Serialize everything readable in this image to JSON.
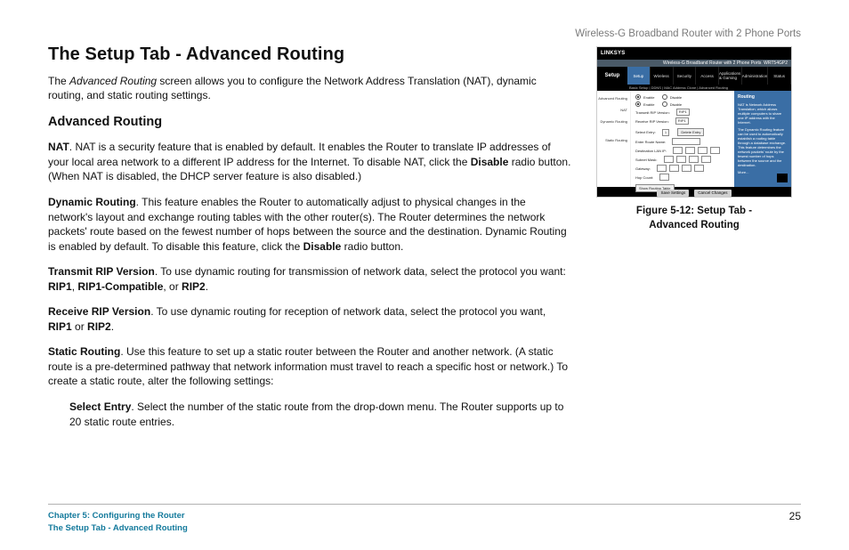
{
  "product_title": "Wireless-G Broadband Router with 2 Phone Ports",
  "page_heading": "The Setup Tab - Advanced Routing",
  "intro_prefix": "The ",
  "intro_ital": "Advanced Routing",
  "intro_suffix": " screen allows you to configure the Network Address Translation (NAT), dynamic routing, and static routing settings.",
  "sub_heading": "Advanced Routing",
  "nat_label": "NAT",
  "nat_text_1": ". NAT is a security feature that is enabled by default. It enables the Router to translate IP addresses of your local area network to a different IP address for the Internet. To disable NAT, click the ",
  "nat_bold_disable": "Disable",
  "nat_text_2": " radio button. (When NAT is disabled, the DHCP server feature is also disabled.)",
  "dyn_label": "Dynamic Routing",
  "dyn_text_1": ". This feature enables the Router to automatically adjust to physical changes in the network's layout and exchange routing tables with the other router(s). The Router determines the network packets' route based on the fewest number of hops between the source and the destination. Dynamic Routing is enabled by default. To disable this feature, click the ",
  "dyn_bold_disable": "Disable",
  "dyn_text_2": " radio button.",
  "trip_label": "Transmit RIP Version",
  "trip_text_1": ". To use dynamic routing for transmission of network data, select the protocol you want: ",
  "trip_b1": "RIP1",
  "trip_sep1": ", ",
  "trip_b2": "RIP1-Compatible",
  "trip_sep2": ", or ",
  "trip_b3": "RIP2",
  "trip_end": ".",
  "rrip_label": "Receive RIP Version",
  "rrip_text_1": ". To use dynamic routing for reception of network data, select the protocol you want, ",
  "rrip_b1": "RIP1",
  "rrip_sep": " or ",
  "rrip_b2": "RIP2",
  "rrip_end": ".",
  "static_label": "Static Routing",
  "static_text": ". Use this feature to set up a static router between the Router and another network. (A static route is a pre-determined pathway that network information must travel to reach a specific host or network.) To create a static route, alter the following settings:",
  "select_label": "Select Entry",
  "select_text": ". Select the number of the static route from the drop-down menu. The Router supports up to 20 static route entries.",
  "figure_caption_line1": "Figure 5-12: Setup Tab -",
  "figure_caption_line2": "Advanced Routing",
  "footer_chapter": "Chapter 5: Configuring the Router",
  "footer_section": "The Setup Tab - Advanced Routing",
  "page_number": "25",
  "thumb": {
    "brand": "LINKSYS",
    "darkband": "Wireless-G Broadband Router with 2 Phone Ports",
    "fw": "WRT54GP2",
    "setup_label": "Setup",
    "tabs": [
      "Setup",
      "Wireless",
      "Security",
      "Access",
      "Applications & Gaming",
      "Administration",
      "Status"
    ],
    "subnav": "Basic Setup | DDNS | MAC Address Clone | Advanced Routing",
    "left_labels": [
      "Advanced Routing",
      "NAT",
      "Dynamic Routing",
      "",
      "Static Routing"
    ],
    "rows": {
      "nat_enable": "Enable",
      "nat_disable": "Disable",
      "dyn_enable": "Enable",
      "dyn_disable": "Disable",
      "tx_label": "Transmit RIP Version:",
      "tx_val": "RIP1",
      "rx_label": "Receive RIP Version:",
      "rx_val": "RIP1",
      "select_label": "Select Entry:",
      "select_val": "1",
      "delete_btn": "Delete Entry",
      "route_name": "Enter Route Name:",
      "dest_label": "Destination LAN IP:",
      "mask_label": "Subnet Mask:",
      "gw_label": "Gateway:",
      "hop_label": "Hop Count:",
      "show_btn": "Show Routing Table"
    },
    "right": {
      "hd": "Routing",
      "t1": "NAT is Network Address Translation, which allows multiple computers to share one IP address with the Internet.",
      "t2": "The Dynamic Routing feature can be used to automatically establish a routing table through a database exchange. This feature determines the network packets' route by the fewest number of hops between the source and the destination.",
      "more": "More..."
    },
    "save": "Save Settings",
    "cancel": "Cancel Changes"
  }
}
